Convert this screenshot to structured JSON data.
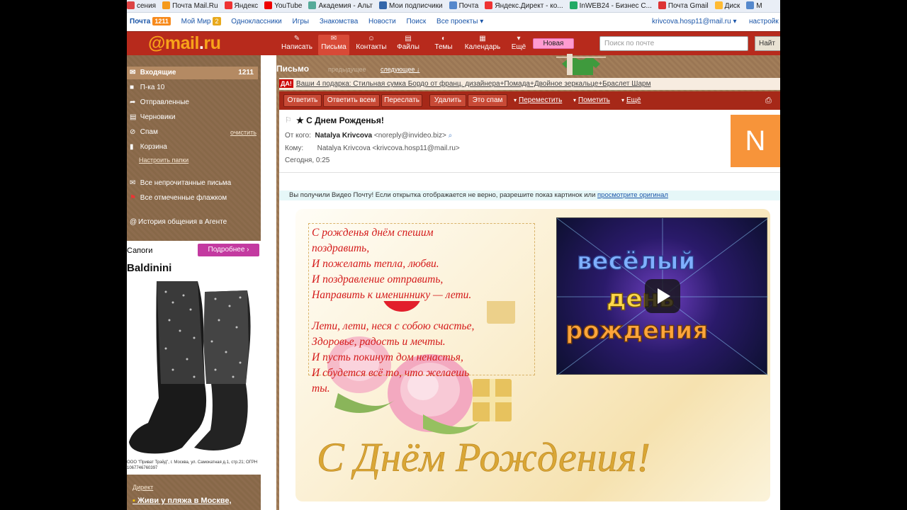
{
  "bookmarks": [
    {
      "label": "сения",
      "color": "#d44"
    },
    {
      "label": "Почта Mail.Ru",
      "color": "#f59a1c"
    },
    {
      "label": "Яндекс",
      "color": "#e33"
    },
    {
      "label": "YouTube",
      "color": "#e00"
    },
    {
      "label": "Академия - Альт",
      "color": "#5a9"
    },
    {
      "label": "Мои подписчики",
      "color": "#36a"
    },
    {
      "label": "Почта",
      "color": "#58c"
    },
    {
      "label": "Яндекс.Директ - ко...",
      "color": "#e33"
    },
    {
      "label": "InWEB24 - Бизнес С...",
      "color": "#2a6"
    },
    {
      "label": "Почта Gmail",
      "color": "#d33"
    },
    {
      "label": "Диск",
      "color": "#fb3"
    },
    {
      "label": "M",
      "color": "#58c"
    }
  ],
  "portal": {
    "mail": "Почта",
    "mail_count": "1211",
    "myworld": "Мой Мир",
    "myworld_count": "2",
    "items": [
      "Одноклассники",
      "Игры",
      "Знакомства",
      "Новости",
      "Поиск",
      "Все проекты ▾"
    ],
    "user": "krivcova.hosp11@mail.ru ▾",
    "settings": "настройк"
  },
  "header": {
    "logo_at": "@",
    "logo_text": "mail",
    "logo_dot": ".",
    "logo_tld": "ru",
    "nav": [
      {
        "icon": "✎",
        "label": "Написать"
      },
      {
        "icon": "✉",
        "label": "Письма"
      },
      {
        "icon": "☺",
        "label": "Контакты"
      },
      {
        "icon": "▤",
        "label": "Файлы"
      },
      {
        "icon": "◐",
        "label": "Темы"
      },
      {
        "icon": "▦",
        "label": "Календарь"
      },
      {
        "icon": "▾",
        "label": "Ещё"
      }
    ],
    "new_badge": "Новая",
    "search_placeholder": "Поиск по почте",
    "search_button": "Найт"
  },
  "sidebar": {
    "folders": [
      {
        "icon": "✉",
        "label": "Входящие",
        "count": "1211"
      },
      {
        "icon": "■",
        "label": "П-ка 10",
        "count": ""
      },
      {
        "icon": "➦",
        "label": "Отправленные",
        "count": ""
      },
      {
        "icon": "▤",
        "label": "Черновики",
        "count": ""
      },
      {
        "icon": "⊘",
        "label": "Спам",
        "count": ""
      },
      {
        "icon": "▮",
        "label": "Корзина",
        "count": ""
      }
    ],
    "spam_clean": "очистить",
    "setup_folders": "Настроить папки",
    "unread": "Все непрочитанные письма",
    "flagged": "Все отмеченные флажком",
    "agent": "История общения в Агенте",
    "ad_title": "Сапоги",
    "ad_more": "Подробнее ›",
    "ad_brand": "Baldinini",
    "ad_footer": "ООО \"Приват Трэйд\", г. Москва, ул. Самокатная д.1, стр.21; ОГРН 1067746760397",
    "direct": "Директ",
    "ad_link": "Живи у пляжа в Москве,"
  },
  "main": {
    "title": "Письмо",
    "prev": "предыдущее",
    "next": "следующее ↓",
    "promo_tag": "ДА!",
    "promo_text": "Ваши 4 подарка: Стильная сумка Бордо от франц. дизайнера+Помада+Двойное зеркальце+Браслет Шарм",
    "toolbar": {
      "reply": "Ответить",
      "reply_all": "Ответить всем",
      "forward": "Переслать",
      "delete": "Удалить",
      "spam": "Это спам",
      "move": "Переместить",
      "mark": "Пометить",
      "more": "Ещё"
    }
  },
  "letter": {
    "subject": "★ С Днем Рожденья!",
    "from_label": "От кого:",
    "from_name": "Natalya Krivcova",
    "from_email": "<noreply@invideo.biz>",
    "to_label": "Кому:",
    "to_value": "Natalya Krivcova <krivcova.hosp11@mail.ru>",
    "date": "Сегодня, 0:25",
    "avatar": "N",
    "notice": "Вы получили Видео Почту! Если открытка отображается не верно, разрешите показ картинок или ",
    "notice_link": "просмотрите оригинал"
  },
  "card": {
    "poem": [
      "С рожденья днём спешим",
      "поздравить,",
      "И пожелать тепла, любви.",
      "И поздравление отправить,",
      "Направить к имениннику — лети.",
      "",
      "Лети, лети, неся с собою счастье,",
      "Здоровье, радость и мечты.",
      "И пусть покинут дом ненастья,",
      "И сбудется всё то, что желаешь",
      "ты."
    ],
    "video_line1": "весёлый",
    "video_line2": "день",
    "video_line3": "рождения",
    "script_text": "С Днём Рождения!"
  }
}
